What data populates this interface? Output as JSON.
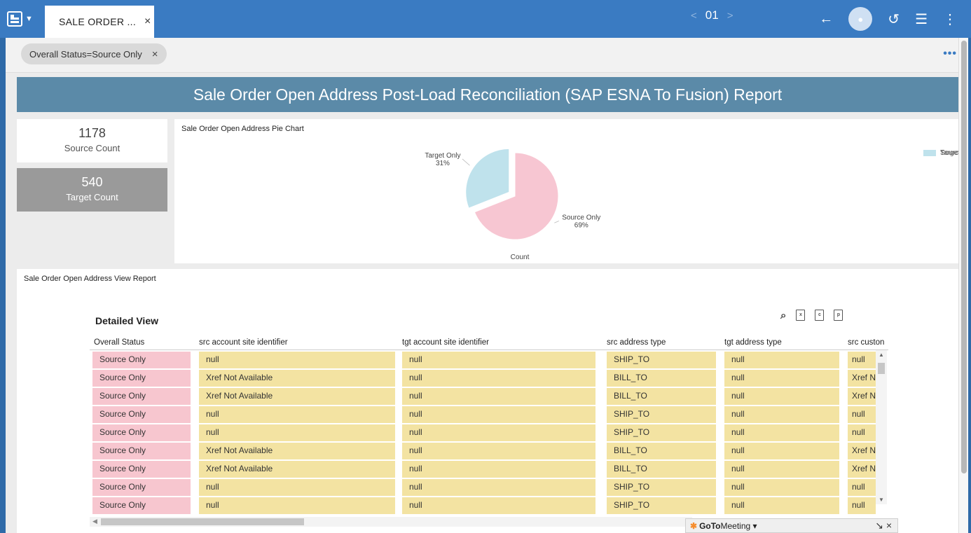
{
  "topbar": {
    "tab_label": "SALE ORDER ...",
    "tab_close": "×",
    "pager_prev": "<",
    "page_number": "01",
    "pager_next": ">"
  },
  "filter": {
    "chip_label": "Overall Status=Source Only",
    "chip_remove": "×",
    "more": "•••"
  },
  "report_title": "Sale Order Open Address Post-Load Reconciliation (SAP ESNA To Fusion) Report",
  "kpis": {
    "source": {
      "value": "1178",
      "label": "Source Count"
    },
    "target": {
      "value": "540",
      "label": "Target Count"
    }
  },
  "chart_panel": {
    "title": "Sale Order Open Address Pie Chart"
  },
  "chart_data": {
    "type": "pie",
    "title": "Sale Order Open Address Pie Chart",
    "xlabel": "Count",
    "categories": [
      "Source Only",
      "Target Only"
    ],
    "values": [
      69,
      31
    ],
    "percent_labels": [
      "69%",
      "31%"
    ],
    "colors": [
      "#f7c6d2",
      "#bfe2ec"
    ],
    "legend_placement": "top-right"
  },
  "table_panel": {
    "report_title": "Sale Order Open Address View Report",
    "detailed_title": "Detailed View",
    "columns": [
      "Overall Status",
      "src account site identifier",
      "tgt account site identifier",
      "src address type",
      "tgt address type",
      "src custon"
    ],
    "rows": [
      [
        "Source Only",
        "null",
        "null",
        "SHIP_TO",
        "null",
        "null"
      ],
      [
        "Source Only",
        "Xref Not Available",
        "null",
        "BILL_TO",
        "null",
        "Xref N"
      ],
      [
        "Source Only",
        "Xref Not Available",
        "null",
        "BILL_TO",
        "null",
        "Xref N"
      ],
      [
        "Source Only",
        "null",
        "null",
        "SHIP_TO",
        "null",
        "null"
      ],
      [
        "Source Only",
        "null",
        "null",
        "SHIP_TO",
        "null",
        "null"
      ],
      [
        "Source Only",
        "Xref Not Available",
        "null",
        "BILL_TO",
        "null",
        "Xref N"
      ],
      [
        "Source Only",
        "Xref Not Available",
        "null",
        "BILL_TO",
        "null",
        "Xref N"
      ],
      [
        "Source Only",
        "null",
        "null",
        "SHIP_TO",
        "null",
        "null"
      ],
      [
        "Source Only",
        "null",
        "null",
        "SHIP_TO",
        "null",
        "null"
      ]
    ]
  },
  "goto": {
    "brand_bold": "GoTo",
    "brand_rest": "Meeting ▾",
    "controls": "↘ ×"
  }
}
